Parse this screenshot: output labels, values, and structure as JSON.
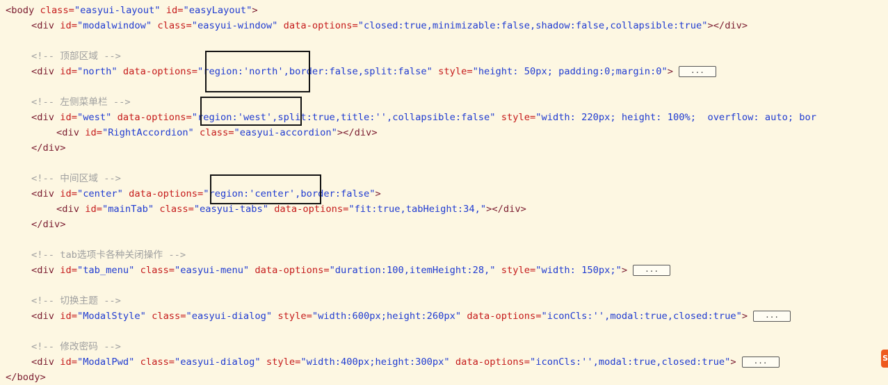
{
  "code": {
    "body_open": {
      "open": "<",
      "tag": "body",
      "attr1": " class=",
      "val1": "\"easyui-layout\"",
      "attr2": " id=",
      "val2": "\"easyLayout\"",
      "close": ">"
    },
    "modalwindow": {
      "open": "<",
      "tag": "div",
      "attr1": " id=",
      "val1": "\"modalwindow\"",
      "attr2": " class=",
      "val2": "\"easyui-window\"",
      "attr3": " data-options=",
      "val3": "\"closed:true,minimizable:false,shadow:false,collapsible:true\"",
      "close": "></",
      "tag_end": "div",
      "end": ">"
    },
    "comment_north": "<!-- 顶部区域 -->",
    "north": {
      "open": "<",
      "tag": "div",
      "attr1": " id=",
      "val1": "\"north\"",
      "attr2": " data-options=",
      "val2": "\"region:'north',border:false,split:false\"",
      "attr3": " style=",
      "val3": "\"height: 50px; padding:0;margin:0\"",
      "close": ">"
    },
    "comment_west": "<!-- 左侧菜单栏 -->",
    "west": {
      "open": "<",
      "tag": "div",
      "attr1": " id=",
      "val1": "\"west\"",
      "attr2": " data-options=",
      "val2": "\"region:'west',split:true,title:'',collapsible:false\"",
      "attr3": " style=",
      "val3": "\"width: 220px; height: 100%;  overflow: auto; bor",
      "close": ""
    },
    "accordion": {
      "open": "<",
      "tag": "div",
      "attr1": " id=",
      "val1": "\"RightAccordion\"",
      "attr2": " class=",
      "val2": "\"easyui-accordion\"",
      "close": "></",
      "tag_end": "div",
      "end": ">"
    },
    "div_close_1": {
      "open": "</",
      "tag": "div",
      "close": ">"
    },
    "comment_center": "<!-- 中间区域 -->",
    "center": {
      "open": "<",
      "tag": "div",
      "attr1": " id=",
      "val1": "\"center\"",
      "attr2": " data-options=",
      "val2": "\"region:'center',border:false\"",
      "close": ">"
    },
    "maintab": {
      "open": "<",
      "tag": "div",
      "attr1": " id=",
      "val1": "\"mainTab\"",
      "attr2": " class=",
      "val2": "\"easyui-tabs\"",
      "attr3": " data-options=",
      "val3": "\"fit:true,tabHeight:34,\"",
      "close": "></",
      "tag_end": "div",
      "end": ">"
    },
    "div_close_2": {
      "open": "</",
      "tag": "div",
      "close": ">"
    },
    "comment_tabmenu": "<!-- tab选项卡各种关闭操作 -->",
    "tab_menu": {
      "open": "<",
      "tag": "div",
      "attr1": " id=",
      "val1": "\"tab_menu\"",
      "attr2": " class=",
      "val2": "\"easyui-menu\"",
      "attr3": " data-options=",
      "val3": "\"duration:100,itemHeight:28,\"",
      "attr4": " style=",
      "val4": "\"width: 150px;\"",
      "close": ">"
    },
    "comment_theme": "<!-- 切换主题 -->",
    "modalstyle": {
      "open": "<",
      "tag": "div",
      "attr1": " id=",
      "val1": "\"ModalStyle\"",
      "attr2": " class=",
      "val2": "\"easyui-dialog\"",
      "attr3": " style=",
      "val3": "\"width:600px;height:260px\"",
      "attr4": " data-options=",
      "val4": "\"iconCls:'',modal:true,closed:true\"",
      "close": ">"
    },
    "comment_pwd": "<!-- 修改密码 -->",
    "modalpwd": {
      "open": "<",
      "tag": "div",
      "attr1": " id=",
      "val1": "\"ModalPwd\"",
      "attr2": " class=",
      "val2": "\"easyui-dialog\"",
      "attr3": " style=",
      "val3": "\"width:400px;height:300px\"",
      "attr4": " data-options=",
      "val4": "\"iconCls:'',modal:true,closed:true\"",
      "close": ">"
    },
    "body_close": {
      "open": "</",
      "tag": "body",
      "close": ">"
    },
    "fold_label": "...",
    "badge_text": "S"
  },
  "colors": {
    "background": "#fdf7e2",
    "tag": "#7a1b2f",
    "attribute": "#c51a1a",
    "value": "#1f3bd1",
    "comment": "#a0a0a0",
    "highlight_box": "#111111",
    "badge": "#ee5a1e"
  }
}
